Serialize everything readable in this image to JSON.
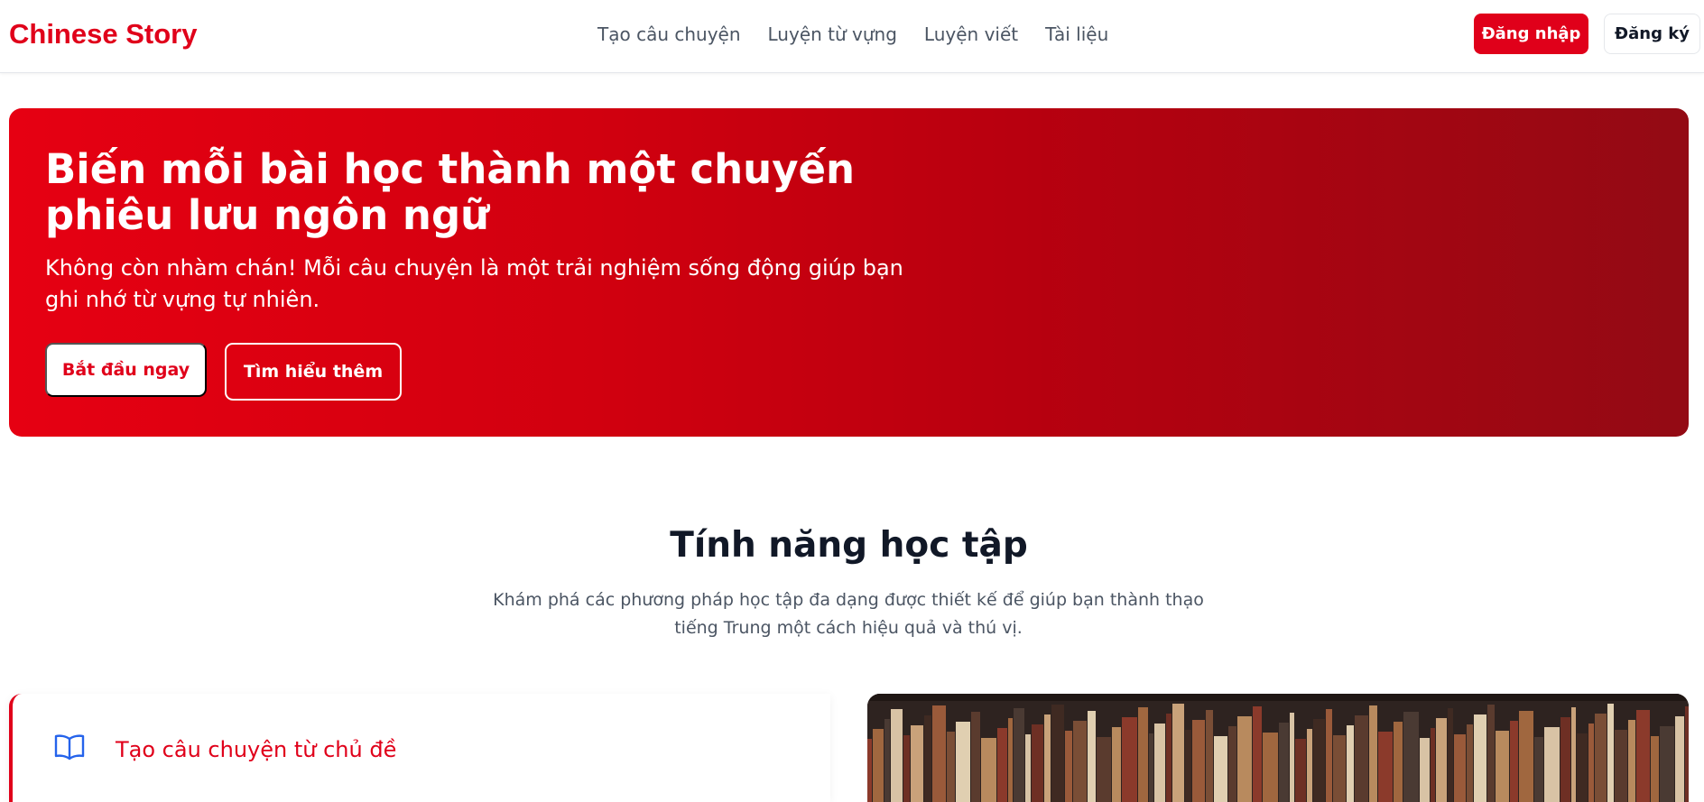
{
  "header": {
    "logo": "Chinese Story",
    "nav": [
      "Tạo câu chuyện",
      "Luyện từ vựng",
      "Luyện viết",
      "Tài liệu"
    ],
    "login_label": "Đăng nhập",
    "register_label": "Đăng ký"
  },
  "hero": {
    "title": "Biến mỗi bài học thành một chuyến phiêu lưu ngôn ngữ",
    "subtitle": "Không còn nhàm chán! Mỗi câu chuyện là một trải nghiệm sống động giúp bạn ghi nhớ từ vựng tự nhiên.",
    "primary_button": "Bắt đầu ngay",
    "secondary_button": "Tìm hiểu thêm"
  },
  "features": {
    "title": "Tính năng học tập",
    "subtitle": "Khám phá các phương pháp học tập đa dạng được thiết kế để giúp bạn thành thạo tiếng Trung một cách hiệu quả và thú vị.",
    "card": {
      "icon": "book-open-icon",
      "title": "Tạo câu chuyện từ chủ đề"
    },
    "image": "bookshelf-photo"
  },
  "colors": {
    "brand": "#e0001a",
    "hero_start": "#e60012",
    "hero_end": "#930a14"
  }
}
